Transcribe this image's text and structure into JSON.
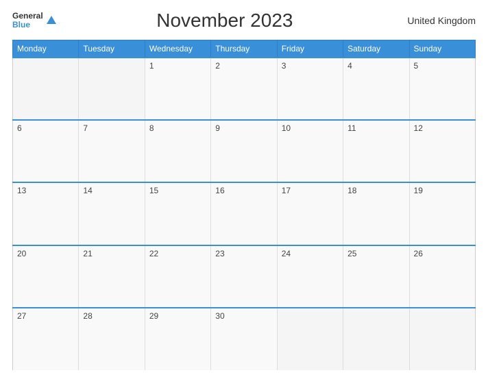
{
  "header": {
    "logo": {
      "general": "General",
      "blue": "Blue"
    },
    "title": "November 2023",
    "region": "United Kingdom"
  },
  "weekdays": [
    "Monday",
    "Tuesday",
    "Wednesday",
    "Thursday",
    "Friday",
    "Saturday",
    "Sunday"
  ],
  "weeks": [
    [
      "",
      "",
      "1",
      "2",
      "3",
      "4",
      "5"
    ],
    [
      "6",
      "7",
      "8",
      "9",
      "10",
      "11",
      "12"
    ],
    [
      "13",
      "14",
      "15",
      "16",
      "17",
      "18",
      "19"
    ],
    [
      "20",
      "21",
      "22",
      "23",
      "24",
      "25",
      "26"
    ],
    [
      "27",
      "28",
      "29",
      "30",
      "",
      "",
      ""
    ]
  ]
}
